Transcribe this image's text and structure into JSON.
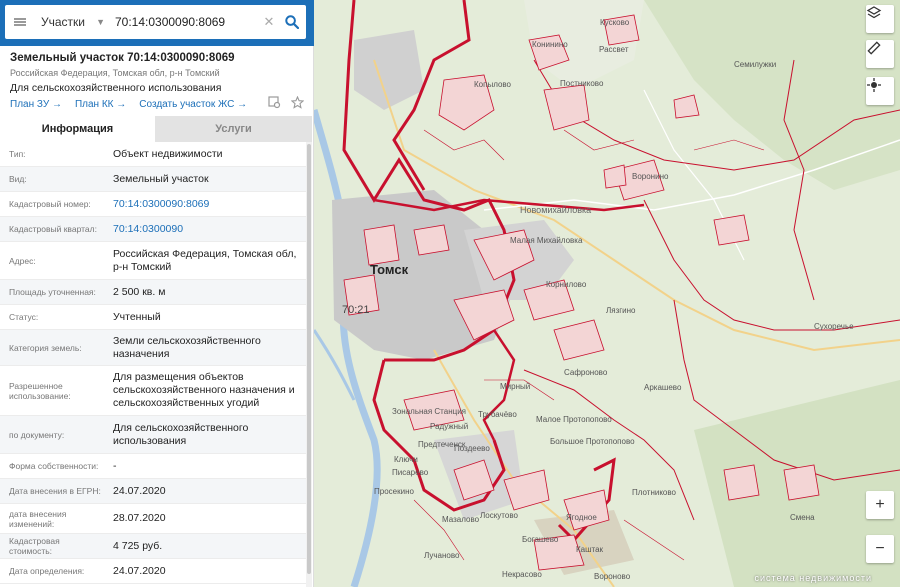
{
  "search": {
    "type_label": "Участки",
    "value": "70:14:0300090:8069"
  },
  "card": {
    "title": "Земельный участок 70:14:0300090:8069",
    "address_line": "Российская Федерация, Томская обл, р-н Томский",
    "purpose": "Для сельскохозяйственного использования",
    "links": [
      "План ЗУ →",
      "План КК →",
      "Создать участок ЖС →"
    ]
  },
  "tabs": [
    {
      "label": "Информация",
      "active": true
    },
    {
      "label": "Услуги",
      "active": false
    }
  ],
  "attributes": [
    {
      "label": "Тип:",
      "value": "Объект недвижимости"
    },
    {
      "label": "Вид:",
      "value": "Земельный участок"
    },
    {
      "label": "Кадастровый номер:",
      "value": "70:14:0300090:8069",
      "link": true
    },
    {
      "label": "Кадастровый квартал:",
      "value": "70:14:0300090",
      "link": true
    },
    {
      "label": "Адрес:",
      "value": "Российская Федерация, Томская обл, р-н Томский"
    },
    {
      "label": "Площадь уточненная:",
      "value": "2 500 кв. м"
    },
    {
      "label": "Статус:",
      "value": "Учтенный"
    },
    {
      "label": "Категория земель:",
      "value": "Земли сельскохозяйственного назначения"
    },
    {
      "label": "Разрешенное использование:",
      "value": "Для размещения объектов сельскохозяйственного назначения и сельскохозяйственных угодий"
    },
    {
      "label": "по документу:",
      "value": "Для сельскохозяйственного использования"
    },
    {
      "label": "Форма собственности:",
      "value": "-"
    },
    {
      "label": "Дата внесения в ЕГРН:",
      "value": "24.07.2020"
    },
    {
      "label": "дата внесения изменений:",
      "value": "28.07.2020"
    },
    {
      "label": "Кадастровая стоимость:",
      "value": "4 725 руб."
    },
    {
      "label": "Дата определения:",
      "value": "24.07.2020"
    }
  ],
  "map": {
    "labels": {
      "tomsk": "Томск",
      "district_code": "70:21",
      "kopylovo": "Копылово",
      "postnikovo": "Постниково",
      "kuskovo": "Кусково",
      "rassvet": "Рассвет",
      "konininо": "Конинино",
      "semiluzhki": "Семилужки",
      "voronino": "Воронино",
      "novomikhaylovka": "Новомихайловка",
      "malaya_mikhaylovka": "Малая Михайловка",
      "kornilovo": "Корнилово",
      "lyaryino": "Лязгино",
      "sukhorechye": "Сухоречье",
      "safronovo": "Сафроново",
      "arkashevo": "Аркашево",
      "mirny": "Мирный",
      "zonalnaya": "Зональная Станция",
      "trubachevo": "Трубачёво",
      "maloe_protopopovo": "Малое Протопопово",
      "bolshoe_protopopovo": "Большое Протопопово",
      "raduzhny": "Радужный",
      "predtechensk": "Предтеченск",
      "klyuchi": "Ключи",
      "pisarevo": "Писарево",
      "prosekino": "Просекино",
      "plotnikovo": "Плотниково",
      "yagodnoe": "Ягодное",
      "loskutovo": "Лоскутово",
      "lучаново": "Лучаново",
      "kashtak": "Каштак",
      "voronovo": "Вороново",
      "nekrasovo": "Некрасово",
      "smena": "Смена",
      "bogashevo": "Богашево",
      "podgornoe": "Поздеево",
      "mazalovo": "Мазалово"
    },
    "attribution": "система недвижимости",
    "colors": {
      "parcel_border": "#c8102e",
      "background": "#e4ecd9",
      "urban": "#bdbdbd",
      "accent": "#1c6fb8"
    }
  }
}
